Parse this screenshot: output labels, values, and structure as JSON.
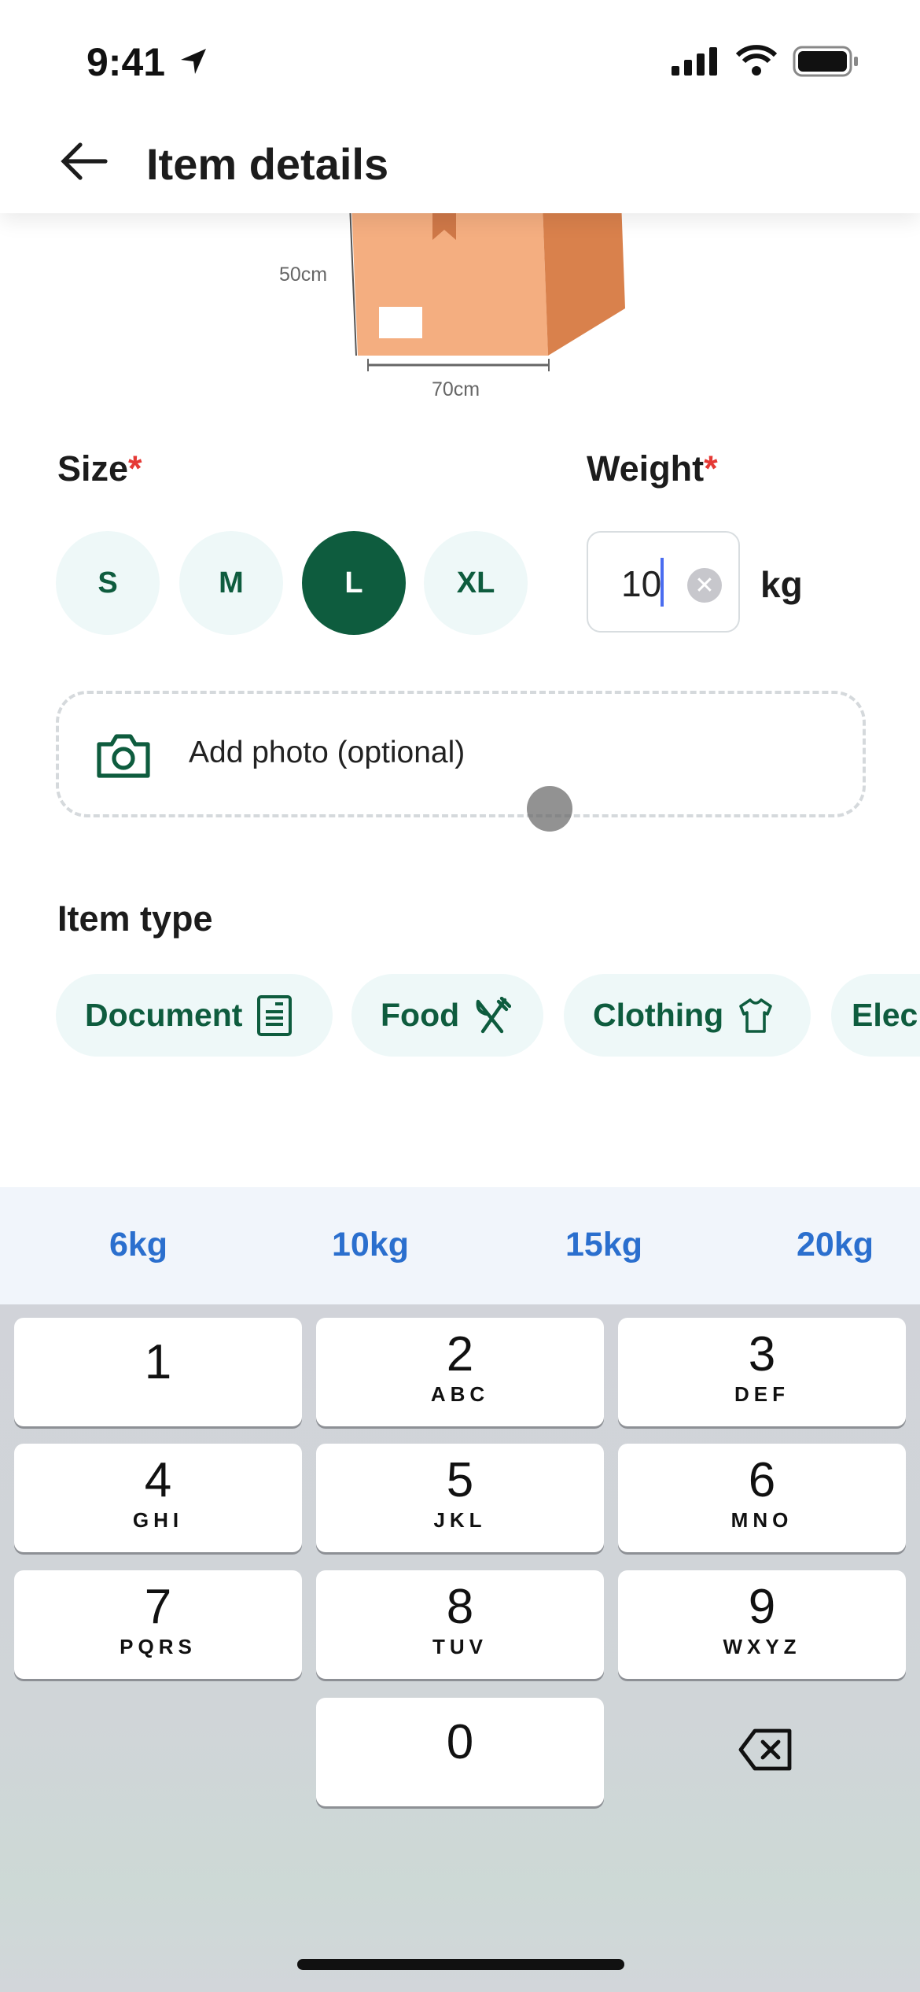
{
  "status": {
    "time": "9:41"
  },
  "header": {
    "title": "Item details"
  },
  "illustration": {
    "height_label": "50cm",
    "width_label": "70cm"
  },
  "size": {
    "label": "Size",
    "required": "*",
    "options": [
      "S",
      "M",
      "L",
      "XL"
    ],
    "selected": "L"
  },
  "weight": {
    "label": "Weight",
    "required": "*",
    "value": "10",
    "unit": "kg"
  },
  "photo": {
    "label": "Add photo (optional)"
  },
  "item_type": {
    "label": "Item type",
    "options": [
      {
        "label": "Document",
        "icon": "document-icon"
      },
      {
        "label": "Food",
        "icon": "utensils-icon"
      },
      {
        "label": "Clothing",
        "icon": "tshirt-icon"
      },
      {
        "label": "Elec",
        "icon": ""
      }
    ]
  },
  "suggestions": [
    "6kg",
    "10kg",
    "15kg",
    "20kg"
  ],
  "keyboard": {
    "keys": [
      {
        "n": "1",
        "l": ""
      },
      {
        "n": "2",
        "l": "ABC"
      },
      {
        "n": "3",
        "l": "DEF"
      },
      {
        "n": "4",
        "l": "GHI"
      },
      {
        "n": "5",
        "l": "JKL"
      },
      {
        "n": "6",
        "l": "MNO"
      },
      {
        "n": "7",
        "l": "PQRS"
      },
      {
        "n": "8",
        "l": "TUV"
      },
      {
        "n": "9",
        "l": "WXYZ"
      },
      {
        "n": "0",
        "l": ""
      }
    ]
  },
  "colors": {
    "accent": "#0e5c3e",
    "chip_bg": "#eef8f8",
    "suggestion": "#2b6fce",
    "required": "#e53935"
  }
}
